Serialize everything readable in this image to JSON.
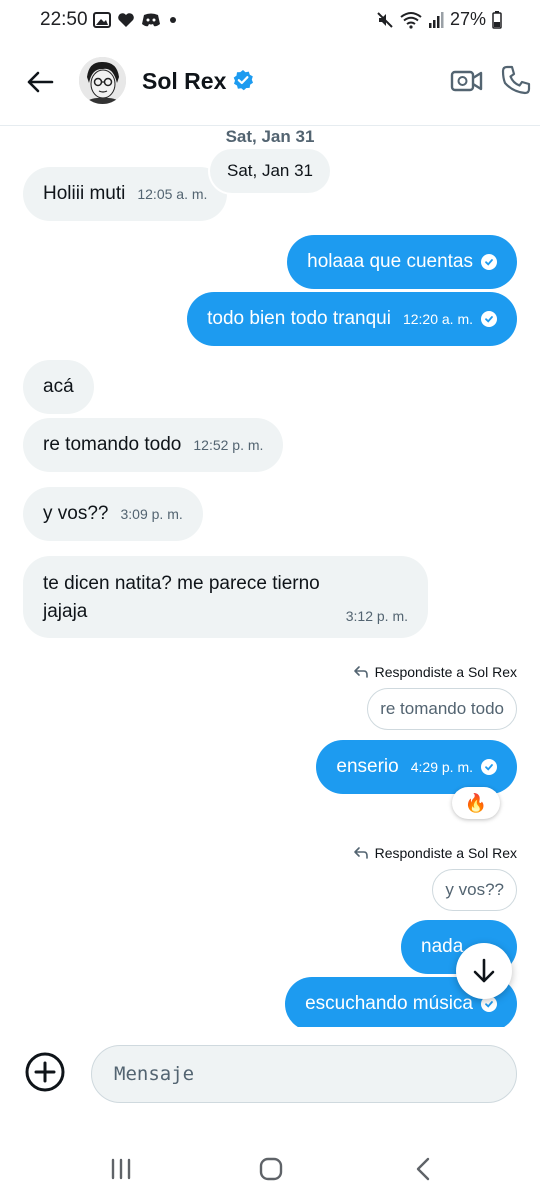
{
  "status_bar": {
    "time": "22:50",
    "battery": "27%",
    "left_icons": [
      "gallery-icon",
      "heart-icon",
      "discord-icon",
      "dot-icon"
    ],
    "right_icons": [
      "mute-icon",
      "wifi-icon",
      "signal-icon",
      "battery-icon"
    ]
  },
  "header": {
    "contact_name": "Sol Rex",
    "verified": true,
    "icons": [
      "back-arrow-icon",
      "verified-badge-icon",
      "video-call-icon",
      "phone-icon"
    ]
  },
  "chat": {
    "date_top": "Sat, Jan 31",
    "date_pill": "Sat, Jan 31",
    "messages": [
      {
        "dir": "in",
        "text": "Holiii muti",
        "time": "12:05 a. m."
      },
      {
        "dir": "out",
        "text": "holaaa que cuentas",
        "time": ""
      },
      {
        "dir": "out",
        "text": "todo bien todo tranqui",
        "time": "12:20 a. m."
      },
      {
        "dir": "in",
        "text": "acá",
        "time": ""
      },
      {
        "dir": "in",
        "text": "re tomando todo",
        "time": "12:52 p. m."
      },
      {
        "dir": "in",
        "text": "y vos??",
        "time": "3:09 p. m."
      },
      {
        "dir": "in",
        "text_line1": "te dicen natita? me parece tierno",
        "text_line2": "jajaja",
        "time": "3:12 p. m."
      },
      {
        "dir": "out",
        "reply_label": "Respondiste a Sol Rex",
        "quoted": "re tomando todo",
        "text": "enserio",
        "time": "4:29 p. m.",
        "reaction": "🔥"
      },
      {
        "dir": "out",
        "reply_label": "Respondiste a Sol Rex",
        "quoted": "y vos??",
        "text": "nada",
        "time": ""
      },
      {
        "dir": "out",
        "text": "escuchando música",
        "time": ""
      }
    ]
  },
  "composer": {
    "placeholder": "Mensaje",
    "value": ""
  },
  "colors": {
    "accent": "#1d9bf0",
    "incoming_bubble": "#eff3f4",
    "text_primary": "#0f1419",
    "text_secondary": "#536471"
  }
}
